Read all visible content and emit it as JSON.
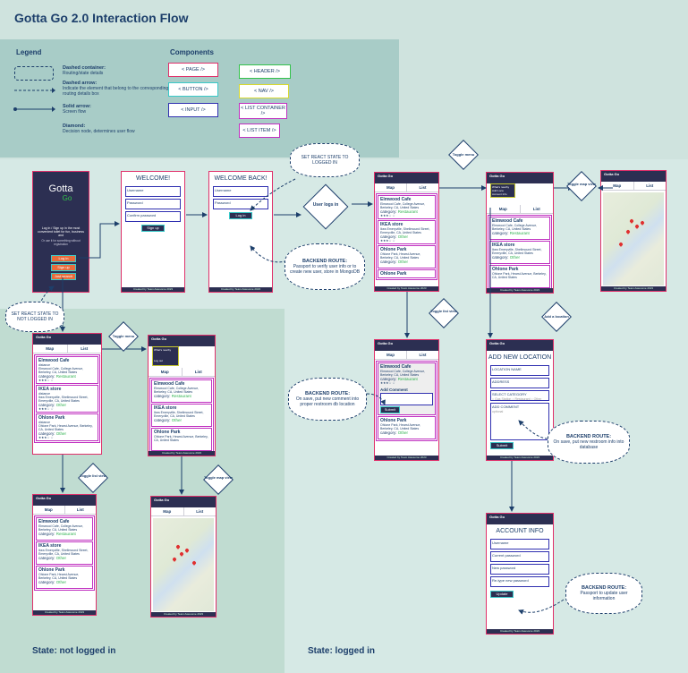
{
  "title": "Gotta Go 2.0 Interaction Flow",
  "legend": {
    "heading": "Legend",
    "dashed_container_title": "Dashed container:",
    "dashed_container_desc": "Routing/state details",
    "dashed_arrow_title": "Dashed arrow:",
    "dashed_arrow_desc": "Indicate the element that belong to the corresponding routing details box",
    "solid_arrow_title": "Solid arrow:",
    "solid_arrow_desc": "Screen flow",
    "diamond_title": "Diamond:",
    "diamond_desc": "Decision node, determines user flow"
  },
  "components": {
    "heading": "Components",
    "page": "< PAGE />",
    "header": "< HEADER />",
    "button": "< BUTTON />",
    "nav": "< NAV />",
    "input": "< INPUT />",
    "list_container": "< LIST CONTAINER />",
    "list_item": "< LIST ITEM />",
    "colors": {
      "page": "#e0306a",
      "header": "#33c24a",
      "button": "#39c9c9",
      "nav": "#d8d830",
      "input": "#3030b0",
      "list_container": "#c030c0",
      "list_item": "#c030c0"
    }
  },
  "states": {
    "not_logged_in": "State: not logged in",
    "logged_in": "State: logged in"
  },
  "splash": {
    "brand_line1": "Gotta",
    "brand_line2": "Go",
    "text1": "Log in / Sign up in the most convenient toilet for fun, business and",
    "text2": "Or use it for something without registration",
    "login": "Log in",
    "signup": "Sign up",
    "guest": "Just search"
  },
  "signup": {
    "heading": "WELCOME!",
    "username": "Username",
    "password": "Password",
    "confirm": "Confirm password",
    "button": "Sign up"
  },
  "login": {
    "heading": "WELCOME BACK!",
    "username": "Username",
    "password": "Password",
    "button": "Log in"
  },
  "nav": {
    "brand": "Gotta Go",
    "map_tab": "Map",
    "list_tab": "List",
    "footer": "Created by Team Awesome 2023"
  },
  "menu": {
    "item1": "What's nearby",
    "item2": "Add Loca",
    "item3": "Account Info",
    "logout": "Log out"
  },
  "places": [
    {
      "name": "Elmwood Cafe",
      "distance": "distance",
      "address": "Elmwood Cafe, College Avenue, Berkeley, CA, United States",
      "category_label": "category:",
      "category": "Restaurant",
      "rating": "★★★☆ ☆"
    },
    {
      "name": "IKEA store",
      "distance": "distance",
      "address": "Ikea Emeryville, Shellmound Street, Emeryville, CA, United States",
      "category_label": "category:",
      "category": "Other",
      "rating": "★★★☆ ☆"
    },
    {
      "name": "Ohlone Park",
      "distance": "distance",
      "address": "Ohlone Park, Hearst Avenue, Berkeley, CA, United States",
      "category_label": "category:",
      "category": "Other",
      "rating": "★★★☆ ☆"
    },
    {
      "name": "Ohlone Park",
      "distance": "distance",
      "address": "",
      "category_label": "",
      "category": "",
      "rating": ""
    }
  ],
  "comment": {
    "label": "Add Comment",
    "button": "Submit"
  },
  "add_location": {
    "heading": "ADD NEW LOCATION",
    "name": "LOCATION NAME",
    "address": "ADDRESS",
    "category": "SELECT CATEGORY",
    "opt1": "Gas Station",
    "opt2": "Restaurant",
    "opt3": "Other",
    "comment": "ADD COMMENT",
    "optional": "optional",
    "button": "Submit"
  },
  "account": {
    "heading": "ACCOUNT INFO",
    "username": "Username",
    "current": "Current password",
    "new": "New password",
    "retype": "Re-type new password",
    "button": "Update"
  },
  "notes": {
    "set_logged_in": "SET REACT STATE TO LOGGED IN",
    "set_not_logged_in": "SET REACT STATE TO NOT LOGGED IN",
    "backend1_title": "BACKEND ROUTE:",
    "backend1_body": "Passport to verify user info or to create new user, store in MongoDB",
    "backend2_title": "BACKEND ROUTE:",
    "backend2_body": "On save, put new comment into proper restroom db location",
    "backend3_title": "BACKEND ROUTE:",
    "backend3_body": "On save, put new restroom info into database",
    "backend4_title": "BACKEND ROUTE:",
    "backend4_body": "Passport to update user information"
  },
  "decisions": {
    "user_logs_in": "User logs in",
    "toggle_menu": "Toggle menu",
    "toggle_map": "Toggle map view",
    "toggle_list": "Toggle list view",
    "add_location": "Add a location"
  }
}
